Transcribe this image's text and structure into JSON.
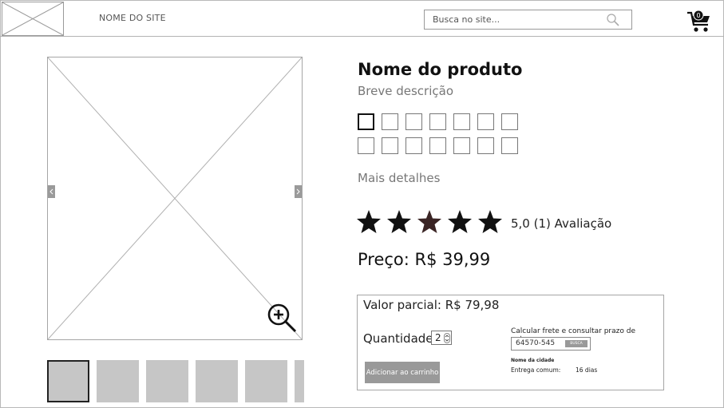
{
  "header": {
    "site_name": "NOME DO SITE",
    "search_placeholder": "Busca no site...",
    "cart_count": "0"
  },
  "product": {
    "name": "Nome do produto",
    "description": "Breve descrição",
    "more_details": "Mais detalhes",
    "rating": {
      "value": 5.0,
      "stars_filled": 5,
      "stars_total": 5,
      "text": "5,0 (1) Avaliação"
    },
    "price_label": "Preço: R$ 39,99",
    "swatches": {
      "count": 14,
      "selected_index": 0
    }
  },
  "gallery": {
    "thumbnail_count": 6,
    "selected_index": 0
  },
  "purchase": {
    "partial_value": "Valor parcial: R$ 79,98",
    "quantity_label": "Quantidade",
    "quantity_value": "2",
    "add_to_cart_label": "Adicionar ao carrinho",
    "shipping_title": "Calcular frete e consultar prazo de entrega",
    "cep_value": "64570-545",
    "search_button_label": "BUSCA",
    "city_name": "Nome da cidade",
    "delivery_label": "Entrega comum:",
    "delivery_days": "16 dias"
  },
  "colors": {
    "border": "#a6a6a6",
    "placeholder_gray": "#c6c6c6",
    "button_gray": "#999999",
    "star_dark": "#111111",
    "star_accent": "#3a2424"
  },
  "icons": [
    "search-icon",
    "cart-icon",
    "zoom-in-icon",
    "chevron-left-icon",
    "chevron-right-icon",
    "star-icon"
  ]
}
